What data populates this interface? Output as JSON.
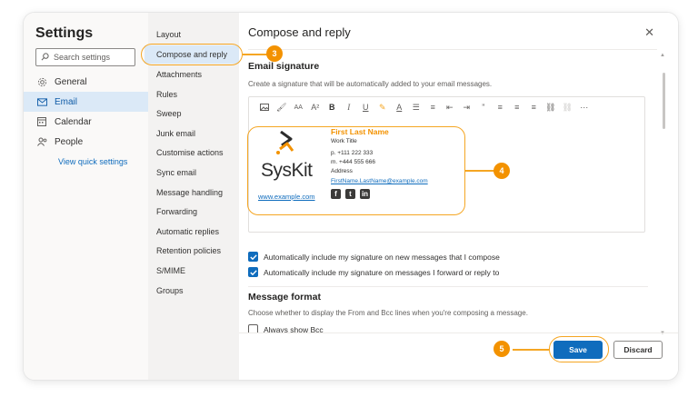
{
  "settings": {
    "title": "Settings",
    "search_placeholder": "Search settings",
    "nav": [
      {
        "label": "General",
        "icon": "gear-icon"
      },
      {
        "label": "Email",
        "icon": "mail-icon"
      },
      {
        "label": "Calendar",
        "icon": "calendar-icon"
      },
      {
        "label": "People",
        "icon": "people-icon"
      }
    ],
    "quick_settings": "View quick settings"
  },
  "email_menu": [
    "Layout",
    "Compose and reply",
    "Attachments",
    "Rules",
    "Sweep",
    "Junk email",
    "Customise actions",
    "Sync email",
    "Message handling",
    "Forwarding",
    "Automatic replies",
    "Retention policies",
    "S/MIME",
    "Groups"
  ],
  "panel": {
    "title": "Compose and reply",
    "close_icon": "close-icon",
    "signature_title": "Email signature",
    "signature_desc": "Create a signature that will be automatically added to your email messages.",
    "signature": {
      "name": "First Last Name",
      "job_title": "Work Title",
      "phone": "p. +111 222 333",
      "mobile": "m. +444 555 666",
      "address": "Address",
      "email": "FirstName.LastName@example.com",
      "url": "www.example.com",
      "logo": "SysKit"
    },
    "check_new": "Automatically include my signature on new messages that I compose",
    "check_forward": "Automatically include my signature on messages I forward or reply to",
    "format_title": "Message format",
    "format_desc": "Choose whether to display the From and Bcc lines when you're composing a message.",
    "bcc_label": "Always show Bcc",
    "save_label": "Save",
    "discard_label": "Discard"
  },
  "callouts": [
    "3",
    "4",
    "5"
  ],
  "colors": {
    "accent": "#0f6cbd",
    "callout": "#f39200",
    "selected": "#dbe9f7"
  }
}
